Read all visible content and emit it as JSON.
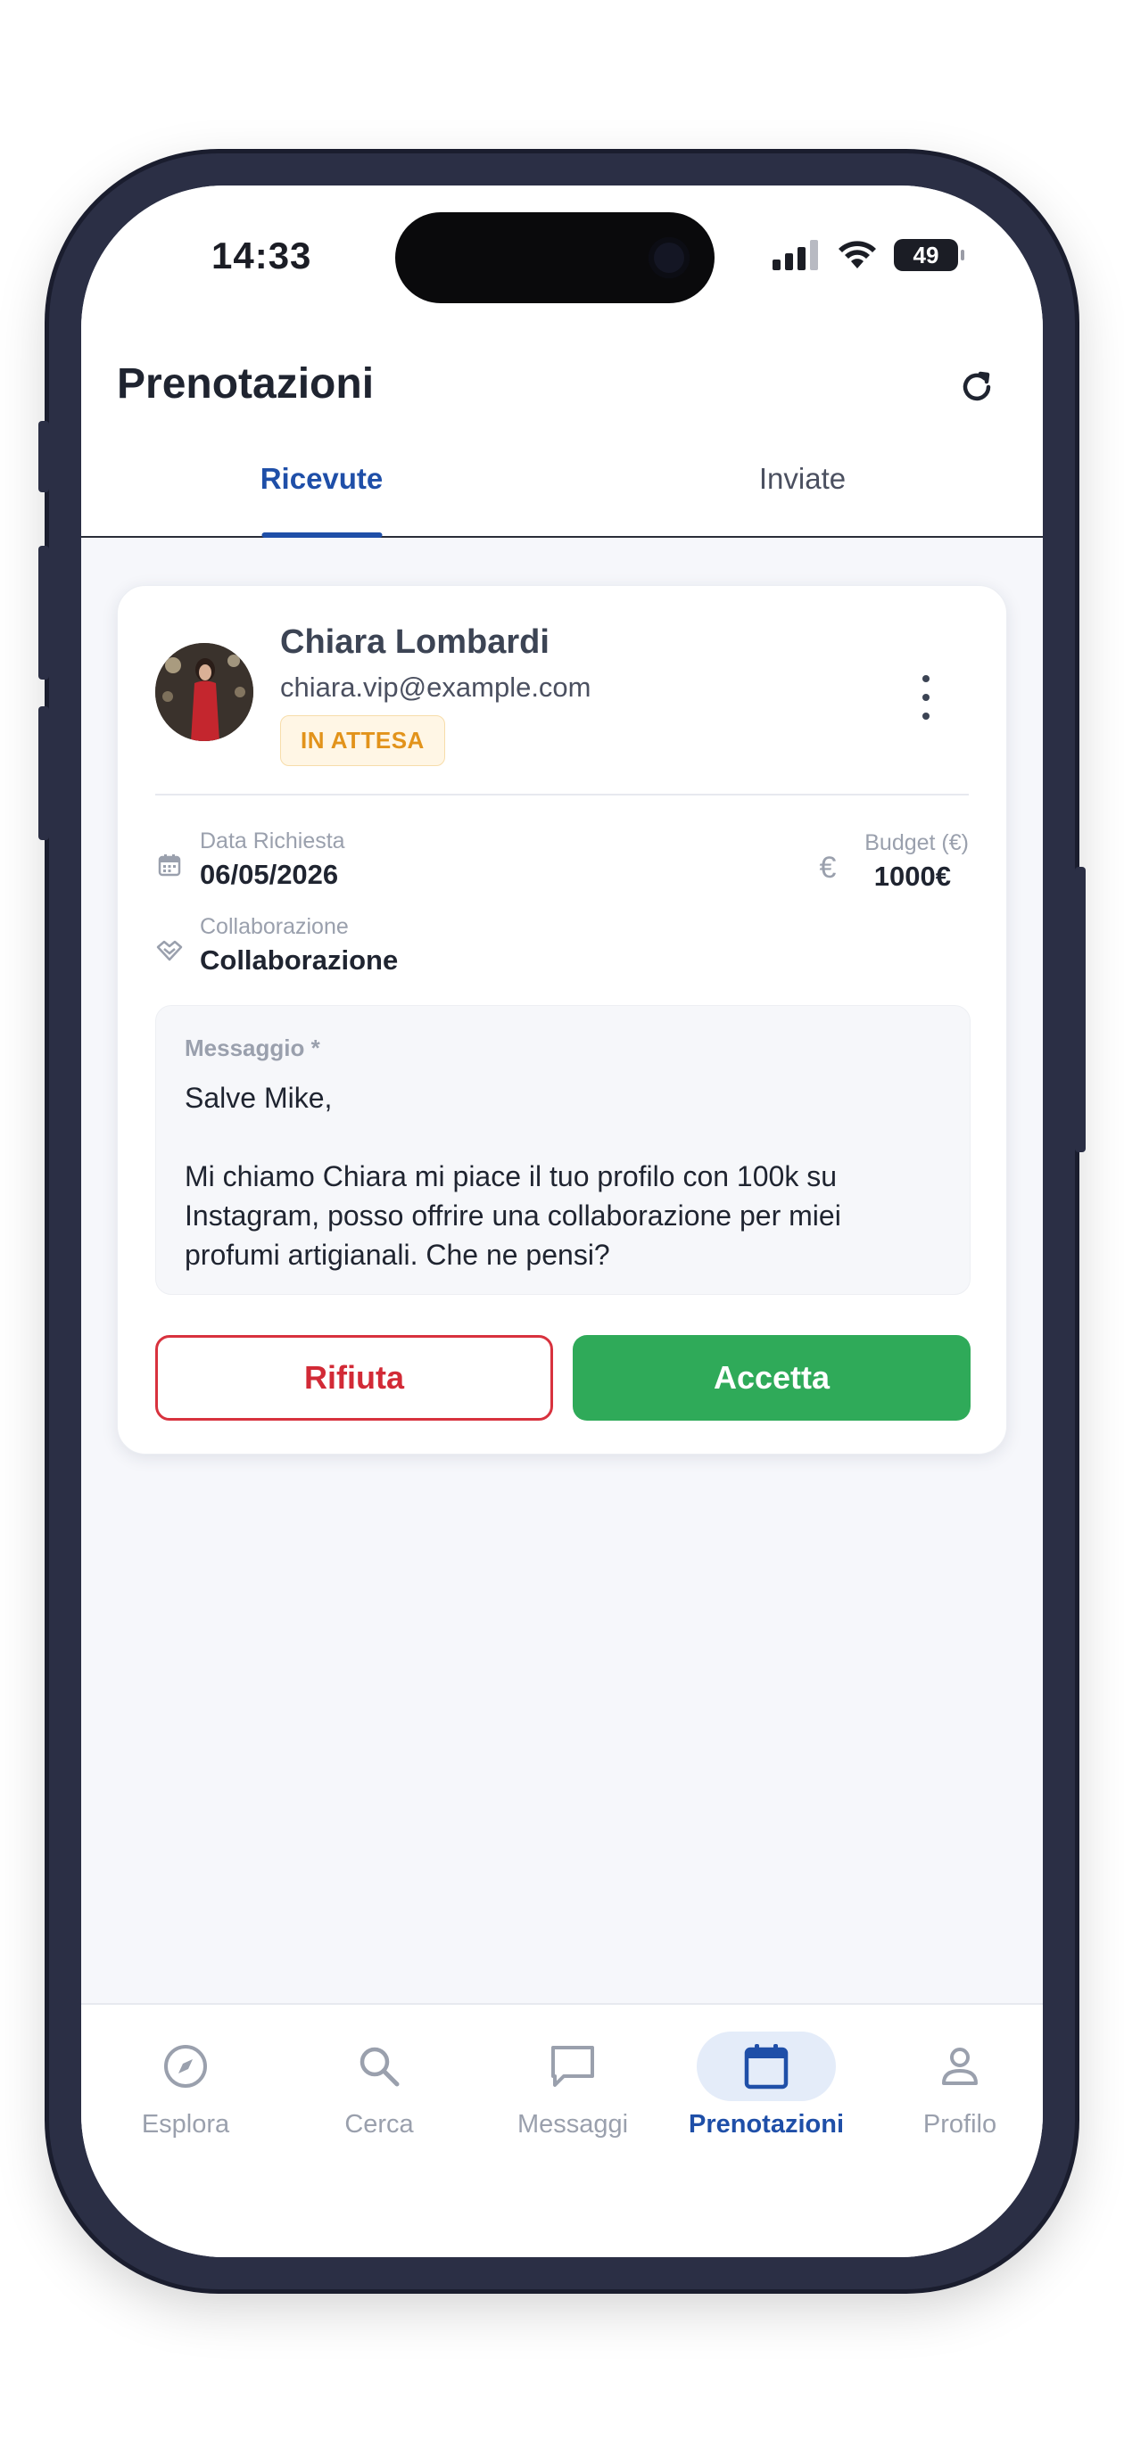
{
  "status_bar": {
    "time": "14:33",
    "battery": "49"
  },
  "header": {
    "title": "Prenotazioni"
  },
  "tabs": [
    {
      "label": "Ricevute",
      "active": true
    },
    {
      "label": "Inviate",
      "active": false
    }
  ],
  "booking": {
    "name": "Chiara Lombardi",
    "email": "chiara.vip@example.com",
    "status": "IN ATTESA",
    "date_label": "Data Richiesta",
    "date_value": "06/05/2026",
    "budget_label": "Budget (€)",
    "budget_value": "1000€",
    "type_label": "Collaborazione",
    "type_value": "Collaborazione",
    "message_label": "Messaggio *",
    "message_text": "Salve Mike,\n\nMi chiamo Chiara mi piace il tuo profilo con 100k su Instagram, posso offrire una collaborazione per miei profumi artigianali. Che ne pensi?",
    "reject_label": "Rifiuta",
    "accept_label": "Accetta"
  },
  "bottom_nav": [
    {
      "label": "Esplora",
      "icon": "compass-icon",
      "active": false
    },
    {
      "label": "Cerca",
      "icon": "search-icon",
      "active": false
    },
    {
      "label": "Messaggi",
      "icon": "chat-icon",
      "active": false
    },
    {
      "label": "Prenotazioni",
      "icon": "calendar-icon",
      "active": true
    },
    {
      "label": "Profilo",
      "icon": "person-icon",
      "active": false
    }
  ],
  "colors": {
    "primary": "#1f4fa8",
    "accept": "#2faa59",
    "reject": "#d22a36",
    "pending": "#e2931b"
  }
}
